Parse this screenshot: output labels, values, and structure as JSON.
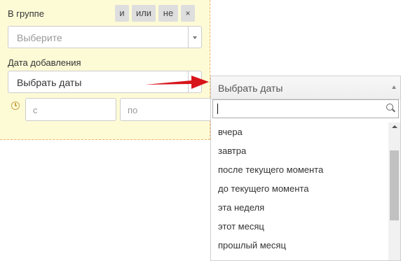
{
  "filter": {
    "group_label": "В группе",
    "operators": [
      "и",
      "или",
      "не"
    ],
    "remove_label": "×",
    "group_select_placeholder": "Выберите",
    "date_label": "Дата добавления",
    "date_select_value": "Выбрать даты",
    "from_placeholder": "с",
    "to_placeholder": "по"
  },
  "dropdown": {
    "title": "Выбрать даты",
    "search_value": "",
    "items": [
      "вчера",
      "завтра",
      "после текущего момента",
      "до текущего момента",
      "эта неделя",
      "этот месяц",
      "прошлый месяц"
    ]
  },
  "colors": {
    "panel_bg": "#fdfbd6",
    "panel_border": "#f0b070",
    "annotation_arrow": "#d7141a",
    "operator_button_bg": "#dedede"
  },
  "icons": {
    "clock": "clock-icon",
    "search": "search-icon",
    "select_arrow": "chevron-down-icon",
    "dropdown_arrow": "chevron-up-icon"
  }
}
